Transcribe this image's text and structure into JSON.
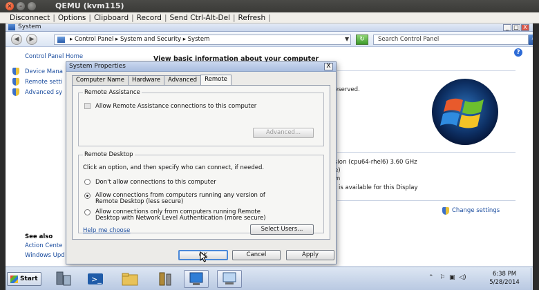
{
  "qemu": {
    "title": "QEMU (kvm115)",
    "toolbar": [
      "Disconnect",
      "Options",
      "Clipboard",
      "Record",
      "Send Ctrl-Alt-Del",
      "Refresh"
    ]
  },
  "system_window": {
    "title": "System",
    "controls": [
      "_",
      "□",
      "X"
    ],
    "address": "▸ Control Panel ▸ System and Security ▸ System",
    "search_placeholder": "Search Control Panel"
  },
  "leftpane": {
    "home": "Control Panel Home",
    "links": [
      "Device Mana",
      "Remote setti",
      "Advanced sy"
    ],
    "see_also": "See also",
    "see_also_links": [
      "Action Cente",
      "Windows Upd"
    ]
  },
  "main": {
    "heading": "View basic information about your computer",
    "reserved": "eserved.",
    "processor": "sion (cpu64-rhel6)   3.60 GHz",
    "line2": "e)",
    "line3": "m",
    "pen_touch": "t is available for this Display",
    "change_settings": "Change settings"
  },
  "dialog": {
    "title": "System Properties",
    "close": "X",
    "tabs": [
      "Computer Name",
      "Hardware",
      "Advanced",
      "Remote"
    ],
    "active_tab": "Remote",
    "remote_assistance": {
      "label": "Remote Assistance",
      "checkbox_label": "Allow Remote Assistance connections to this computer",
      "advanced_button": "Advanced..."
    },
    "remote_desktop": {
      "label": "Remote Desktop",
      "instruction": "Click an option, and then specify who can connect, if needed.",
      "option1": "Don't allow connections to this computer",
      "option2_line1": "Allow connections from computers running any version of",
      "option2_line2": "Remote Desktop (less secure)",
      "option3_line1": "Allow connections only from computers running Remote",
      "option3_line2": "Desktop with Network Level Authentication (more secure)",
      "selected_option": 2,
      "help_link": "Help me choose",
      "select_users": "Select Users..."
    },
    "ok": "OK",
    "cancel": "Cancel",
    "apply": "Apply"
  },
  "taskbar": {
    "start": "Start",
    "time": "6:38 PM",
    "date": "5/28/2014"
  }
}
